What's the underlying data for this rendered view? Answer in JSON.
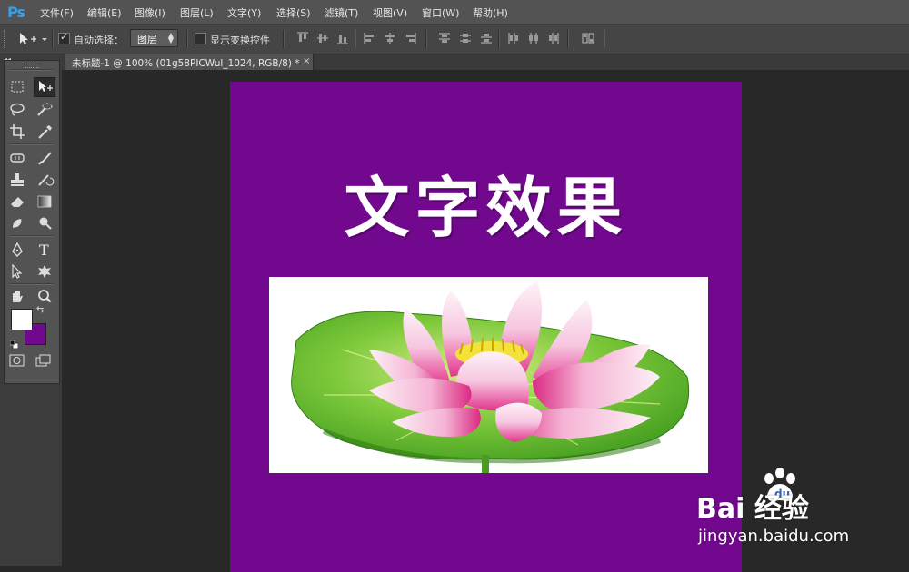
{
  "app": {
    "logo": "Ps"
  },
  "menu": [
    "文件(F)",
    "编辑(E)",
    "图像(I)",
    "图层(L)",
    "文字(Y)",
    "选择(S)",
    "滤镜(T)",
    "视图(V)",
    "窗口(W)",
    "帮助(H)"
  ],
  "options": {
    "auto_select_label": "自动选择：",
    "auto_select_checked": true,
    "layer_select_value": "图层",
    "show_transform_label": "显示变换控件",
    "show_transform_checked": false
  },
  "document": {
    "tab_title": "未标题-1 @ 100% (01g58PICWul_1024, RGB/8) *",
    "close_glyph": "×",
    "canvas_color": "#72088e",
    "canvas_text": "文字效果"
  },
  "colors": {
    "foreground": "#ffffff",
    "background": "#72088e"
  },
  "watermark": {
    "brand": "Bai 经验",
    "url": "jingyan.baidu.com"
  }
}
